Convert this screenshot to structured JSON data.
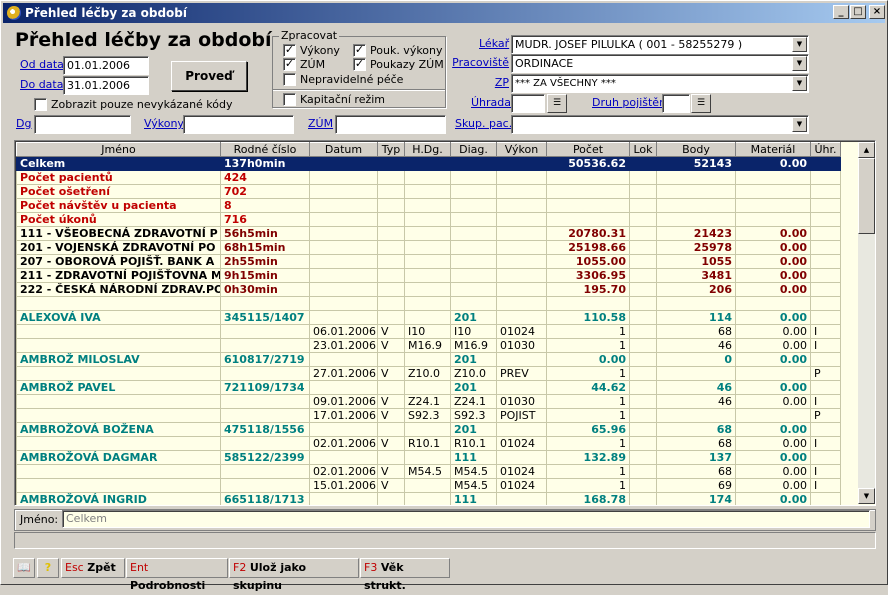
{
  "window": {
    "title": "Přehled léčby za období",
    "min": "_",
    "max": "□",
    "close": "×"
  },
  "header": {
    "title": "Přehled léčby za období"
  },
  "dates": {
    "od_label": "Od data",
    "od_value": "01.01.2006",
    "do_label": "Do data",
    "do_value": "31.01.2006"
  },
  "proved": "Proveď",
  "only_unbilled": "Zobrazit pouze nevykázané kódy",
  "zpracovat": {
    "legend": "Zpracovat",
    "vykony": "Výkony",
    "pouk_vykony": "Pouk. výkony",
    "zum": "ZÚM",
    "poukazy_zum": "Poukazy ZÚM",
    "nepravidelne": "Nepravidelné péče",
    "kapitacni": "Kapitační režim"
  },
  "filters": {
    "lekar_label": "Lékař",
    "lekar_value": "MUDR. JOSEF PILULKA ( 001 - 58255279 )",
    "pracoviste_label": "Pracoviště",
    "pracoviste_value": "ORDINACE",
    "zp_label": "ZP",
    "zp_value": "*** ZA VŠECHNY ***",
    "uhrada_label": "Úhrada",
    "druh_label": "Druh pojištění",
    "skup_label": "Skup. pac."
  },
  "row2": {
    "dg_label": "Dg",
    "vykony_label": "Výkony",
    "zum_label": "ZÚM"
  },
  "columns": [
    "Jméno",
    "Rodné číslo",
    "Datum",
    "Typ",
    "H.Dg.",
    "Diag.",
    "Výkon",
    "Počet",
    "Lok",
    "Body",
    "Materiál",
    "Úhr."
  ],
  "rows": [
    {
      "cls": "sel",
      "c": [
        "Celkem",
        "137h0min",
        "",
        "",
        "",
        "",
        "",
        "50536.62",
        "",
        "52143",
        "0.00",
        ""
      ]
    },
    {
      "cls": "red",
      "c": [
        "Počet pacientů",
        "424",
        "",
        "",
        "",
        "",
        "",
        "",
        "",
        "",
        "",
        ""
      ]
    },
    {
      "cls": "red",
      "c": [
        "Počet ošetření",
        "702",
        "",
        "",
        "",
        "",
        "",
        "",
        "",
        "",
        "",
        ""
      ]
    },
    {
      "cls": "red",
      "c": [
        "Počet návštěv u pacienta",
        "8",
        "",
        "",
        "",
        "",
        "",
        "",
        "",
        "",
        "",
        ""
      ]
    },
    {
      "cls": "red",
      "c": [
        "Počet úkonů",
        "716",
        "",
        "",
        "",
        "",
        "",
        "",
        "",
        "",
        "",
        ""
      ]
    },
    {
      "cls": "dred",
      "c": [
        "111 - VŠEOBECNÁ ZDRAVOTNÍ P",
        "56h5min",
        "",
        "",
        "",
        "",
        "",
        "20780.31",
        "",
        "21423",
        "0.00",
        ""
      ]
    },
    {
      "cls": "dred",
      "c": [
        "201 - VOJENSKÁ ZDRAVOTNÍ PO",
        "68h15min",
        "",
        "",
        "",
        "",
        "",
        "25198.66",
        "",
        "25978",
        "0.00",
        ""
      ]
    },
    {
      "cls": "dred",
      "c": [
        "207 - OBOROVÁ POJIŠŤ. BANK A",
        "2h55min",
        "",
        "",
        "",
        "",
        "",
        "1055.00",
        "",
        "1055",
        "0.00",
        ""
      ]
    },
    {
      "cls": "dred",
      "c": [
        "211 - ZDRAVOTNÍ POJIŠŤOVNA M",
        "9h15min",
        "",
        "",
        "",
        "",
        "",
        "3306.95",
        "",
        "3481",
        "0.00",
        ""
      ]
    },
    {
      "cls": "dred",
      "c": [
        "222 - ČESKÁ NÁRODNÍ ZDRAV.PO",
        "0h30min",
        "",
        "",
        "",
        "",
        "",
        "195.70",
        "",
        "206",
        "0.00",
        ""
      ]
    },
    {
      "cls": "",
      "c": [
        "",
        "",
        "",
        "",
        "",
        "",
        "",
        "",
        "",
        "",
        "",
        ""
      ]
    },
    {
      "cls": "pat",
      "c": [
        "ALEXOVÁ IVA",
        "345115/1407",
        "",
        "",
        "",
        "201",
        "",
        "110.58",
        "",
        "114",
        "0.00",
        ""
      ]
    },
    {
      "cls": "",
      "c": [
        "",
        "",
        "06.01.2006",
        "V",
        "I10",
        "I10",
        "01024",
        "1",
        "",
        "68",
        "0.00",
        "I"
      ]
    },
    {
      "cls": "",
      "c": [
        "",
        "",
        "23.01.2006",
        "V",
        "M16.9",
        "M16.9",
        "01030",
        "1",
        "",
        "46",
        "0.00",
        "I"
      ]
    },
    {
      "cls": "pat",
      "c": [
        "AMBROŽ MILOSLAV",
        "610817/2719",
        "",
        "",
        "",
        "201",
        "",
        "0.00",
        "",
        "0",
        "0.00",
        ""
      ]
    },
    {
      "cls": "",
      "c": [
        "",
        "",
        "27.01.2006",
        "V",
        "Z10.0",
        "Z10.0",
        "PREV",
        "1",
        "",
        "",
        "",
        "P"
      ]
    },
    {
      "cls": "pat",
      "c": [
        "AMBROŽ PAVEL",
        "721109/1734",
        "",
        "",
        "",
        "201",
        "",
        "44.62",
        "",
        "46",
        "0.00",
        ""
      ]
    },
    {
      "cls": "",
      "c": [
        "",
        "",
        "09.01.2006",
        "V",
        "Z24.1",
        "Z24.1",
        "01030",
        "1",
        "",
        "46",
        "0.00",
        "I"
      ]
    },
    {
      "cls": "",
      "c": [
        "",
        "",
        "17.01.2006",
        "V",
        "S92.3",
        "S92.3",
        "POJIST",
        "1",
        "",
        "",
        "",
        "P"
      ]
    },
    {
      "cls": "pat",
      "c": [
        "AMBROŽOVÁ BOŽENA",
        "475118/1556",
        "",
        "",
        "",
        "201",
        "",
        "65.96",
        "",
        "68",
        "0.00",
        ""
      ]
    },
    {
      "cls": "",
      "c": [
        "",
        "",
        "02.01.2006",
        "V",
        "R10.1",
        "R10.1",
        "01024",
        "1",
        "",
        "68",
        "0.00",
        "I"
      ]
    },
    {
      "cls": "pat",
      "c": [
        "AMBROŽOVÁ DAGMAR",
        "585122/2399",
        "",
        "",
        "",
        "111",
        "",
        "132.89",
        "",
        "137",
        "0.00",
        ""
      ]
    },
    {
      "cls": "",
      "c": [
        "",
        "",
        "02.01.2006",
        "V",
        "M54.5",
        "M54.5",
        "01024",
        "1",
        "",
        "68",
        "0.00",
        "I"
      ]
    },
    {
      "cls": "",
      "c": [
        "",
        "",
        "15.01.2006",
        "V",
        "",
        "M54.5",
        "01024",
        "1",
        "",
        "69",
        "0.00",
        "I"
      ]
    },
    {
      "cls": "pat",
      "c": [
        "AMBROŽOVÁ INGRID",
        "665118/1713",
        "",
        "",
        "",
        "111",
        "",
        "168.78",
        "",
        "174",
        "0.00",
        ""
      ]
    }
  ],
  "footer": {
    "jmeno_label": "Jméno:",
    "jmeno_value": "Celkem"
  },
  "statusbar": {
    "esc_key": "Esc",
    "esc_label": "Zpět",
    "ent_key": "Ent",
    "ent_label": "Podrobnosti",
    "f2_key": "F2",
    "f2_label": "Ulož jako skupinu",
    "f3_key": "F3",
    "f3_label": "Věk strukt."
  }
}
